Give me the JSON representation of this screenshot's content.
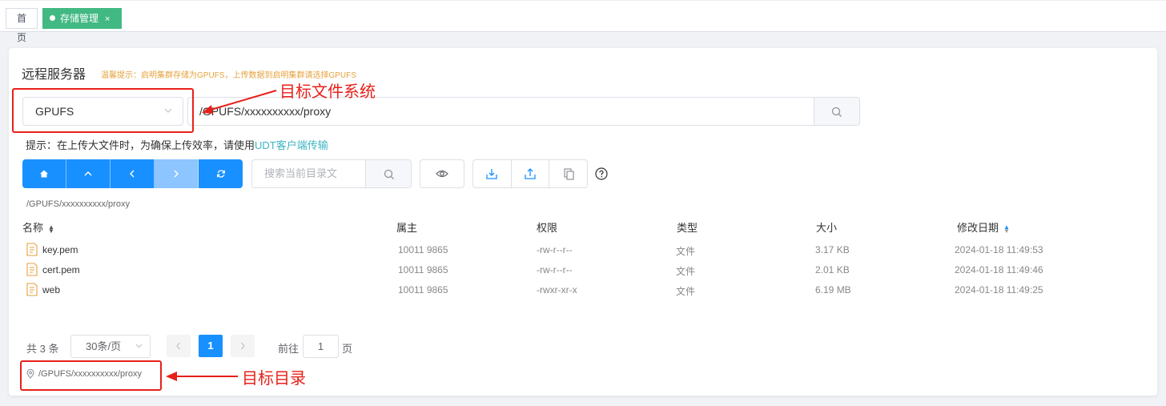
{
  "tabs": [
    {
      "label": "首页"
    },
    {
      "label": "存储管理",
      "close": "×"
    }
  ],
  "panel": {
    "title": "远程服务器",
    "warm_tip": "温馨提示：启明集群存储为GPUFS，上传数据到启明集群请选择GPUFS"
  },
  "fs_select": {
    "value": "GPUFS"
  },
  "path_input": {
    "value": "/GPUFS/xxxxxxxxxx/proxy"
  },
  "hint": {
    "prefix": "提示：在上传大文件时，为确保上传效率，请使用",
    "link": "UDT客户端传输"
  },
  "toolbar": {
    "nav_buttons": [
      "home-icon",
      "up-arrow-icon",
      "back-icon",
      "forward-icon",
      "refresh-icon"
    ],
    "filter_placeholder": "搜索当前目录文"
  },
  "current_path": "/GPUFS/xxxxxxxxxx/proxy",
  "table": {
    "columns": [
      "名称",
      "属主",
      "权限",
      "类型",
      "大小",
      "修改日期"
    ],
    "rows": [
      {
        "name": "key.pem",
        "owner": "10011 9865",
        "perm": "-rw-r--r--",
        "type": "文件",
        "size": "3.17 KB",
        "mtime": "2024-01-18 11:49:53"
      },
      {
        "name": "cert.pem",
        "owner": "10011 9865",
        "perm": "-rw-r--r--",
        "type": "文件",
        "size": "2.01 KB",
        "mtime": "2024-01-18 11:49:46"
      },
      {
        "name": "web",
        "owner": "10011 9865",
        "perm": "-rwxr-xr-x",
        "type": "文件",
        "size": "6.19 MB",
        "mtime": "2024-01-18 11:49:25"
      }
    ]
  },
  "pager": {
    "total": "共 3 条",
    "page_size": "30条/页",
    "current_page": "1",
    "goto_label": "前往",
    "goto_value": "1",
    "goto_unit": "页"
  },
  "location": "/GPUFS/xxxxxxxxxx/proxy",
  "annotations": {
    "target_fs": "目标文件系统",
    "target_dir": "目标目录",
    "color": "#e8201a"
  },
  "colors": {
    "primary": "#1890ff",
    "tab_active": "#42b983",
    "warn": "#e6a23c",
    "link": "#3bb4c1"
  }
}
